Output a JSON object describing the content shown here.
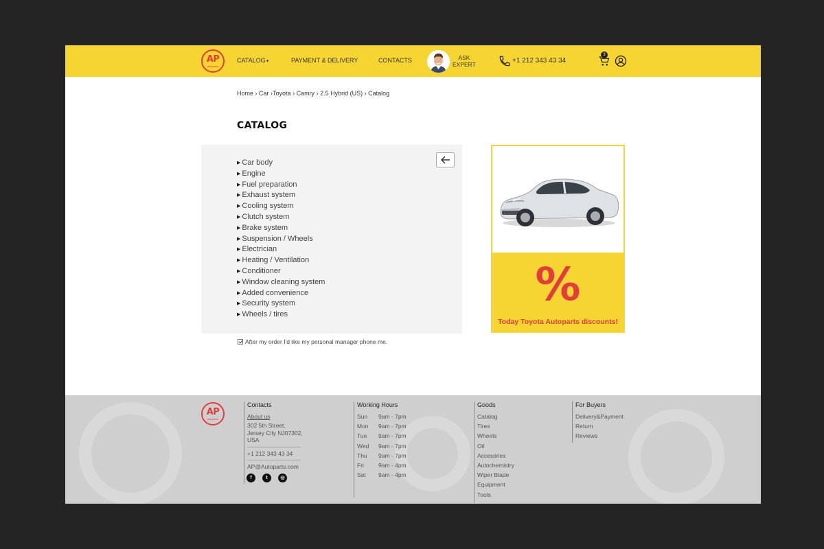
{
  "header": {
    "logo_text": "AP",
    "logo_sub": "autoparts",
    "nav": {
      "catalog": "CATALOG",
      "payment": "PAYMENT & DELIVERY",
      "contacts": "CONTACTS"
    },
    "ask_expert_line1": "ASK",
    "ask_expert_line2": "EXPERT",
    "phone": "+1 212 343 43 34",
    "cart_count": "3",
    "colors": {
      "brand_yellow": "#f6d431",
      "accent_red": "#e33c3c"
    }
  },
  "breadcrumb": {
    "items": [
      "Home",
      "Car",
      "Toyota",
      "Camry",
      "2.5 Hybrid (US)",
      "Catalog"
    ]
  },
  "page_title": "CATALOG",
  "catalog": {
    "items": [
      "Car body",
      "Engine",
      "Fuel preparation",
      "Exhaust system",
      "Cooling system",
      "Clutch system",
      "Brake system",
      "Suspension / Wheels",
      "Electrician",
      "Heating / Ventilation",
      "Conditioner",
      "Window cleaning system",
      "Added convenience",
      "Security system",
      "Wheels / tires"
    ],
    "checkbox_label": "After my order I'd like my personal manager phone me."
  },
  "promo": {
    "symbol": "%",
    "text": "Today Toyota Autoparts discounts!"
  },
  "footer": {
    "logo_text": "AP",
    "logo_sub": "autoparts",
    "contacts": {
      "title": "Contacts",
      "about": "About us",
      "address": "302 5th Street, Jersey City NJ07302, USA",
      "phone": "+1 212 343 43 34",
      "email": "AP@Autoparts.com"
    },
    "hours": {
      "title": "Working Hours",
      "rows": [
        {
          "day": "Sun",
          "time": "9am - 7pm"
        },
        {
          "day": "Mon",
          "time": "9am - 7pm"
        },
        {
          "day": "Tue",
          "time": "9am - 7pm"
        },
        {
          "day": "Wed",
          "time": "9am - 7pm"
        },
        {
          "day": "Thu",
          "time": "9am - 7pm"
        },
        {
          "day": "Fri",
          "time": "9am - 4pm"
        },
        {
          "day": "Sat",
          "time": "9am - 4pm"
        }
      ]
    },
    "goods": {
      "title": "Goods",
      "items": [
        "Catalog",
        "Tires",
        "Wheels",
        "Oil",
        "Accesories",
        "Autochemistry",
        "Wiper Blade",
        "Equipment",
        "Tools"
      ]
    },
    "buyers": {
      "title": "For Buyers",
      "items": [
        "Delivery&Payment",
        "Return",
        "Reviews"
      ]
    },
    "social_icons": [
      "facebook-icon",
      "twitter-icon",
      "instagram-icon"
    ]
  }
}
